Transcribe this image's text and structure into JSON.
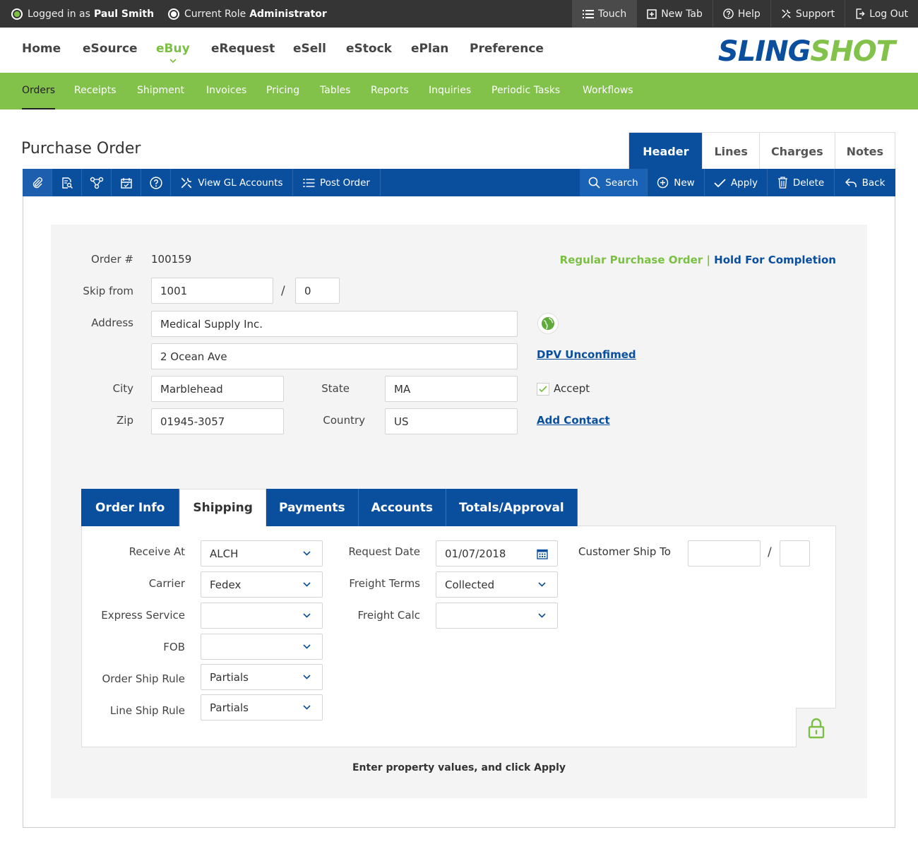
{
  "topbar": {
    "logged_prefix": "Logged in as",
    "user": "Paul Smith",
    "role_prefix": "Current Role",
    "role": "Administrator",
    "links": [
      {
        "label": "Touch"
      },
      {
        "label": "New Tab"
      },
      {
        "label": "Help"
      },
      {
        "label": "Support"
      },
      {
        "label": "Log Out"
      }
    ]
  },
  "nav": {
    "items": [
      "Home",
      "eSource",
      "eBuy",
      "eRequest",
      "eSell",
      "eStock",
      "ePlan",
      "Preference"
    ],
    "active": "eBuy"
  },
  "logo": {
    "part1": "SLING",
    "part2": "SHOT"
  },
  "subnav": {
    "items": [
      "Orders",
      "Receipts",
      "Shipment",
      "Invoices",
      "Pricing",
      "Tables",
      "Reports",
      "Inquiries",
      "Periodic Tasks",
      "Workflows"
    ],
    "active": "Orders"
  },
  "page": {
    "title": "Purchase Order",
    "tabs": [
      "Header",
      "Lines",
      "Charges",
      "Notes"
    ],
    "active_tab": "Header"
  },
  "toolbar": {
    "view_gl": "View GL Accounts",
    "post_order": "Post Order",
    "search": "Search",
    "new": "New",
    "apply": "Apply",
    "delete": "Delete",
    "back": "Back"
  },
  "form": {
    "order_label": "Order #",
    "order_value": "100159",
    "status_type": "Regular Purchase Order",
    "status_sep": "|",
    "status_state": "Hold For Completion",
    "skip_label": "Skip from",
    "skip_value": "1001",
    "skip_sep": "/",
    "skip_suffix": "0",
    "address_label": "Address",
    "address1": "Medical Supply Inc.",
    "address2": "2 Ocean Ave",
    "dpv_link": "DPV Unconfimed",
    "city_label": "City",
    "city": "Marblehead",
    "state_label": "State",
    "state": "MA",
    "accept_label": "Accept",
    "zip_label": "Zip",
    "zip": "01945-3057",
    "country_label": "Country",
    "country": "US",
    "add_contact": "Add Contact"
  },
  "inner_tabs": {
    "items": [
      "Order Info",
      "Shipping",
      "Payments",
      "Accounts",
      "Totals/Approval"
    ],
    "active": "Shipping"
  },
  "shipping": {
    "receive_at_label": "Receive At",
    "receive_at": "ALCH",
    "carrier_label": "Carrier",
    "carrier": "Fedex",
    "express_label": "Express Service",
    "express": "",
    "fob_label": "FOB",
    "fob": "",
    "order_ship_rule_label": "Order Ship Rule",
    "order_ship_rule": "Partials",
    "line_ship_rule_label": "Line Ship Rule",
    "line_ship_rule": "Partials",
    "request_date_label": "Request Date",
    "request_date": "01/07/2018",
    "freight_terms_label": "Freight Terms",
    "freight_terms": "Collected",
    "freight_calc_label": "Freight Calc",
    "freight_calc": "",
    "customer_ship_to_label": "Customer Ship To",
    "customer_ship_to": "",
    "customer_ship_to_sep": "/",
    "customer_ship_to_suffix": ""
  },
  "hint": "Enter property values, and click Apply",
  "colors": {
    "brand_blue": "#0a4f9e",
    "brand_green": "#82c24b",
    "topbar": "#353535"
  }
}
